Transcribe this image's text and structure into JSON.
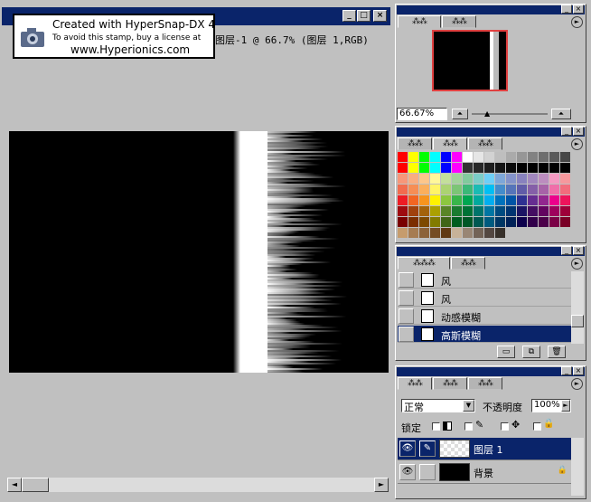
{
  "document": {
    "title": "图层-1 @ 66.7% (图层 1,RGB)",
    "min_label": "_",
    "max_label": "□",
    "close_label": "×",
    "scroll_left": "◄",
    "scroll_right": "►"
  },
  "stamp": {
    "line1": "Created with HyperSnap-DX 4",
    "line2": "To avoid this stamp, buy a license at",
    "line3": "www.Hyperionics.com"
  },
  "navigator": {
    "tabs": [
      "⁂⁂",
      "⁂⁂"
    ],
    "zoom": "66.67%",
    "menu": "►"
  },
  "swatches_panel": {
    "tabs": [
      "⁂⁂",
      "⁂⁂",
      "⁂⁂"
    ],
    "menu": "►",
    "rows": [
      [
        "#ff0000",
        "#ffff00",
        "#00ff00",
        "#00ffff",
        "#0000ff",
        "#ff00ff",
        "#ffffff",
        "#e6e6e6",
        "#d2d2d2",
        "#bebebe",
        "#aaaaaa",
        "#969696",
        "#828282",
        "#6e6e6e",
        "#5a5a5a",
        "#464646"
      ],
      [
        "#ff0000",
        "#ffff00",
        "#00ff00",
        "#00ffff",
        "#0000ff",
        "#ff00ff",
        "#323232",
        "#282828",
        "#1e1e1e",
        "#141414",
        "#0a0a0a",
        "#000000",
        "#000000",
        "#000000",
        "#000000",
        "#000000"
      ],
      [
        "#f7977a",
        "#f9ad81",
        "#fdc68a",
        "#fff79a",
        "#c4df9b",
        "#a3d39c",
        "#82ca9d",
        "#7bcdc8",
        "#6ecff6",
        "#7ea7d8",
        "#8493ca",
        "#8882be",
        "#a187be",
        "#bc8dbf",
        "#f49ac2",
        "#f6989d"
      ],
      [
        "#f26c4f",
        "#f68e55",
        "#fbaf5c",
        "#fff467",
        "#acd372",
        "#7cc576",
        "#3bb878",
        "#1abbb4",
        "#00bff3",
        "#438ccb",
        "#5574b9",
        "#605ca8",
        "#855fa8",
        "#a763a8",
        "#f06ea9",
        "#f26d7d"
      ],
      [
        "#ed1c24",
        "#f26522",
        "#f7941d",
        "#fff200",
        "#8dc73f",
        "#39b54a",
        "#00a651",
        "#00a99d",
        "#00aeef",
        "#0072bc",
        "#0054a6",
        "#2e3192",
        "#662d91",
        "#92278f",
        "#ec008c",
        "#ed145b"
      ],
      [
        "#9e0b0f",
        "#a0410d",
        "#a3620a",
        "#aba000",
        "#598527",
        "#1a7b30",
        "#007236",
        "#00746b",
        "#0076a3",
        "#004b80",
        "#003471",
        "#1b1464",
        "#440e62",
        "#630460",
        "#9e005d",
        "#9e0039"
      ],
      [
        "#790000",
        "#7b2e00",
        "#7d4900",
        "#827b00",
        "#406618",
        "#005e20",
        "#005826",
        "#005952",
        "#005b7f",
        "#003663",
        "#002157",
        "#0d004c",
        "#32004b",
        "#4b0049",
        "#7b0046",
        "#7a0026"
      ],
      [
        "#c69c6d",
        "#a67c52",
        "#8c6239",
        "#754c24",
        "#603913",
        "#c7b299",
        "#998675",
        "#736357",
        "#534741",
        "#37302a",
        "#c0c0c0",
        "#c0c0c0",
        "#c0c0c0",
        "#c0c0c0",
        "#c0c0c0",
        "#c0c0c0"
      ]
    ]
  },
  "actions": {
    "tabs": [
      "⁂⁂⁂",
      "⁂⁂"
    ],
    "menu": "►",
    "items": [
      "风",
      "风",
      "动感模糊",
      "高斯模糊"
    ],
    "footer_icons": [
      "▭",
      "⧉",
      "🗑"
    ]
  },
  "layers": {
    "tabs": [
      "⁂⁂",
      "⁂⁂",
      "⁂⁂"
    ],
    "menu": "►",
    "blend_mode": "正常",
    "opacity_label": "不透明度",
    "opacity_value": "100%",
    "lock_label": "锁定",
    "lock_icons": [
      "✎",
      "✥",
      "🔒"
    ],
    "items": [
      {
        "name": "图层 1",
        "eye": "👁",
        "brush": "✎"
      },
      {
        "name": "背景",
        "eye": "👁",
        "brush": "",
        "lock": "🔒"
      }
    ]
  }
}
